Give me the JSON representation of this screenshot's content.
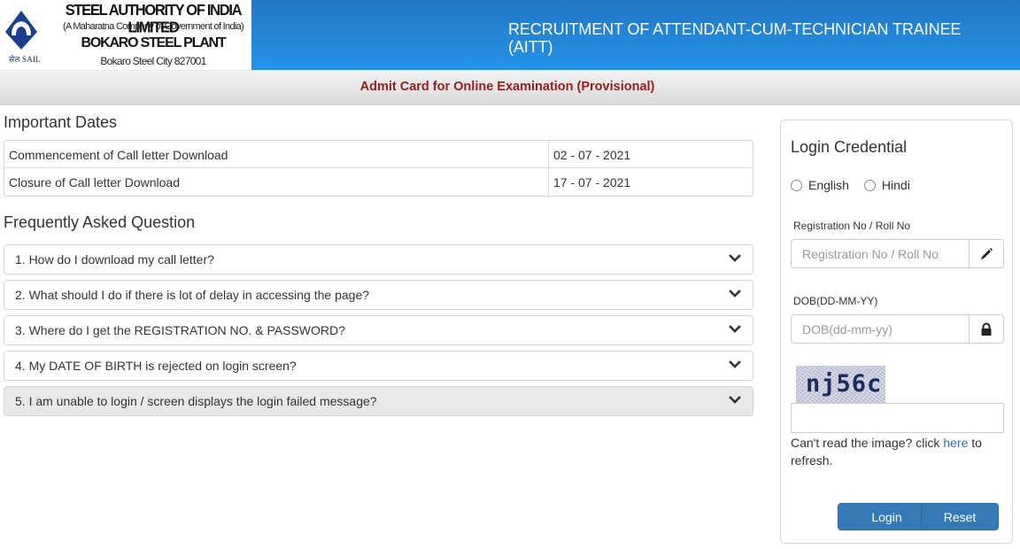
{
  "header": {
    "logo": {
      "emblem_icon": "sail-emblem-icon",
      "caption": "सेल SAIL"
    },
    "org_name": "STEEL AUTHORITY OF INDIA LIMITED",
    "org_subtitle": "(A Maharatna  Company of Government of India)",
    "plant_name": "BOKARO STEEL PLANT",
    "plant_address": "Bokaro Steel City 827001",
    "recruitment_title": "RECRUITMENT OF ATTENDANT-CUM-TECHNICIAN TRAINEE (AITT)",
    "colors": {
      "header_blue": "#2386d8",
      "subheader_text": "#9b1c1c"
    }
  },
  "subheader": {
    "title": "Admit Card for Online Examination (Provisional)"
  },
  "important_dates": {
    "title": "Important Dates",
    "rows": [
      {
        "label": "Commencement of Call letter Download",
        "value": "02 - 07 - 2021"
      },
      {
        "label": "Closure of Call letter Download",
        "value": "17 - 07 - 2021"
      }
    ]
  },
  "faq": {
    "title": "Frequently Asked Question",
    "items": [
      {
        "question": "1. How do I download my call letter?",
        "icon": "chevron-down-icon",
        "active": false
      },
      {
        "question": "2. What should I do if there is lot of delay in accessing the page?",
        "icon": "chevron-down-icon",
        "active": false
      },
      {
        "question": "3. Where do I get the REGISTRATION NO. & PASSWORD?",
        "icon": "chevron-down-icon",
        "active": false
      },
      {
        "question": "4. My DATE OF BIRTH is rejected on login screen?",
        "icon": "chevron-down-icon",
        "active": false
      },
      {
        "question": "5. I am unable to login / screen displays the login failed message?",
        "icon": "chevron-down-icon",
        "active": true
      }
    ]
  },
  "login": {
    "title": "Login Credential",
    "languages": [
      {
        "label": "English",
        "selected": false
      },
      {
        "label": "Hindi",
        "selected": false
      }
    ],
    "registration": {
      "label": "Registration No / Roll No",
      "placeholder": "Registration No / Roll No",
      "value": "",
      "icon": "pencil-icon"
    },
    "dob": {
      "label": "DOB(DD-MM-YY)",
      "placeholder": "DOB(dd-mm-yy)",
      "value": "",
      "icon": "lock-icon"
    },
    "captcha": {
      "text": "nj56c",
      "input_value": "",
      "help_prefix": "Can't read the image? click ",
      "help_link": "here",
      "help_suffix": " to refresh."
    },
    "buttons": {
      "login": "Login",
      "reset": "Reset"
    },
    "colors": {
      "button_blue": "#337ab7",
      "link_blue": "#2a6ebb"
    }
  }
}
